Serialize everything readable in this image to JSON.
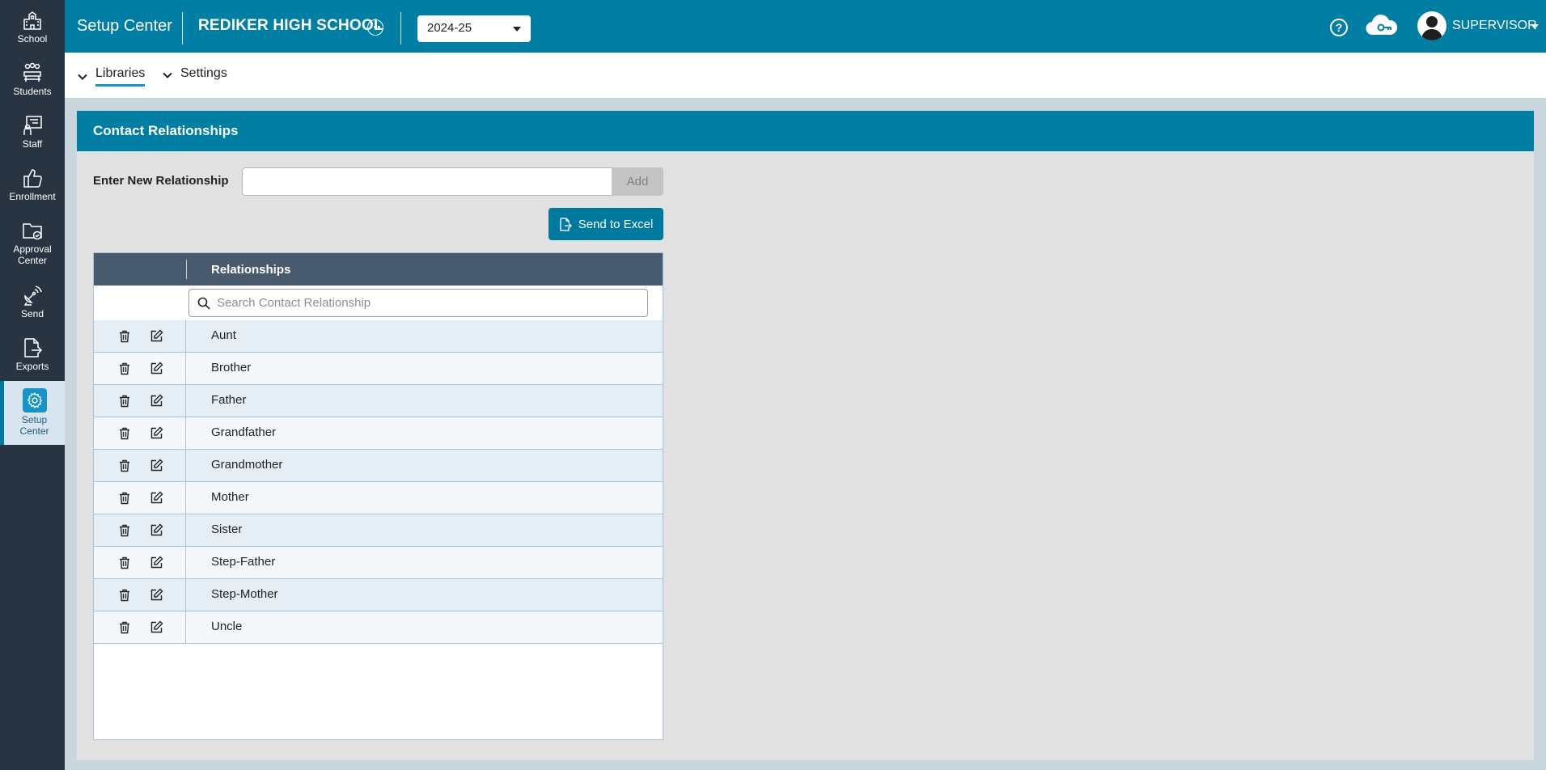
{
  "app": {
    "title": "Setup Center"
  },
  "header": {
    "school_name": "REDIKER HIGH SCHOOL",
    "school_year": "2024-25",
    "user_name": "SUPERVISOR"
  },
  "sidebar": {
    "items": [
      {
        "label": "School",
        "icon": "school-icon"
      },
      {
        "label": "Students",
        "icon": "students-icon"
      },
      {
        "label": "Staff",
        "icon": "staff-icon"
      },
      {
        "label": "Enrollment",
        "icon": "thumbs-up-icon"
      },
      {
        "label_line1": "Approval",
        "label_line2": "Center",
        "icon": "folder-check-icon"
      },
      {
        "label": "Send",
        "icon": "satellite-icon"
      },
      {
        "label": "Exports",
        "icon": "file-export-icon"
      },
      {
        "label_line1": "Setup",
        "label_line2": "Center",
        "icon": "gear-icon",
        "active": true
      }
    ]
  },
  "subnav": {
    "libraries": "Libraries",
    "settings": "Settings"
  },
  "panel": {
    "title": "Contact Relationships",
    "new_label": "Enter New Relationship",
    "new_value": "",
    "add_label": "Add",
    "excel_label": "Send to Excel"
  },
  "grid": {
    "column_header": "Relationships",
    "search_placeholder": "Search Contact Relationship",
    "rows": [
      "Aunt",
      "Brother",
      "Father",
      "Grandfather",
      "Grandmother",
      "Mother",
      "Sister",
      "Step-Father",
      "Step-Mother",
      "Uncle"
    ]
  },
  "colors": {
    "brand": "#007ea3",
    "sidebar": "#283441",
    "grid_header": "#485a6e",
    "accent": "#1794c7"
  }
}
